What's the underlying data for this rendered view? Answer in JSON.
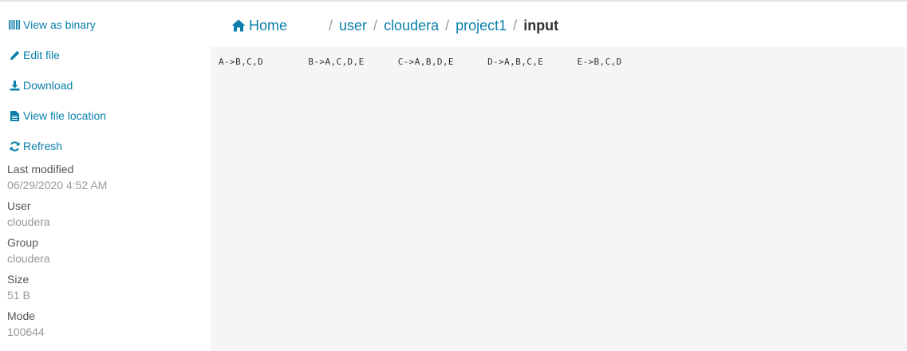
{
  "sidebar": {
    "actions": {
      "view_binary": "View as binary",
      "edit_file": "Edit file",
      "download": "Download",
      "view_location": "View file location",
      "refresh": "Refresh"
    },
    "properties": {
      "last_modified": {
        "label": "Last modified",
        "value": "06/29/2020 4:52 AM"
      },
      "user": {
        "label": "User",
        "value": "cloudera"
      },
      "group": {
        "label": "Group",
        "value": "cloudera"
      },
      "size": {
        "label": "Size",
        "value": "51 B"
      },
      "mode": {
        "label": "Mode",
        "value": "100644"
      }
    },
    "icons": {
      "view_binary": "barcode-icon",
      "edit_file": "pencil-icon",
      "download": "download-icon",
      "view_location": "file-text-icon",
      "refresh": "refresh-icon"
    }
  },
  "breadcrumb": {
    "home": "Home",
    "separator": "/",
    "segments": [
      "user",
      "cloudera",
      "project1"
    ],
    "current": "input",
    "home_icon": "home-icon"
  },
  "file": {
    "content": "A->B,C,D\tB->A,C,D,E\tC->A,B,D,E\tD->A,B,C,E\tE->B,C,D"
  },
  "colors": {
    "link": "#0b7fab",
    "panel_bg": "#f5f5f5",
    "muted_text": "#999999"
  }
}
